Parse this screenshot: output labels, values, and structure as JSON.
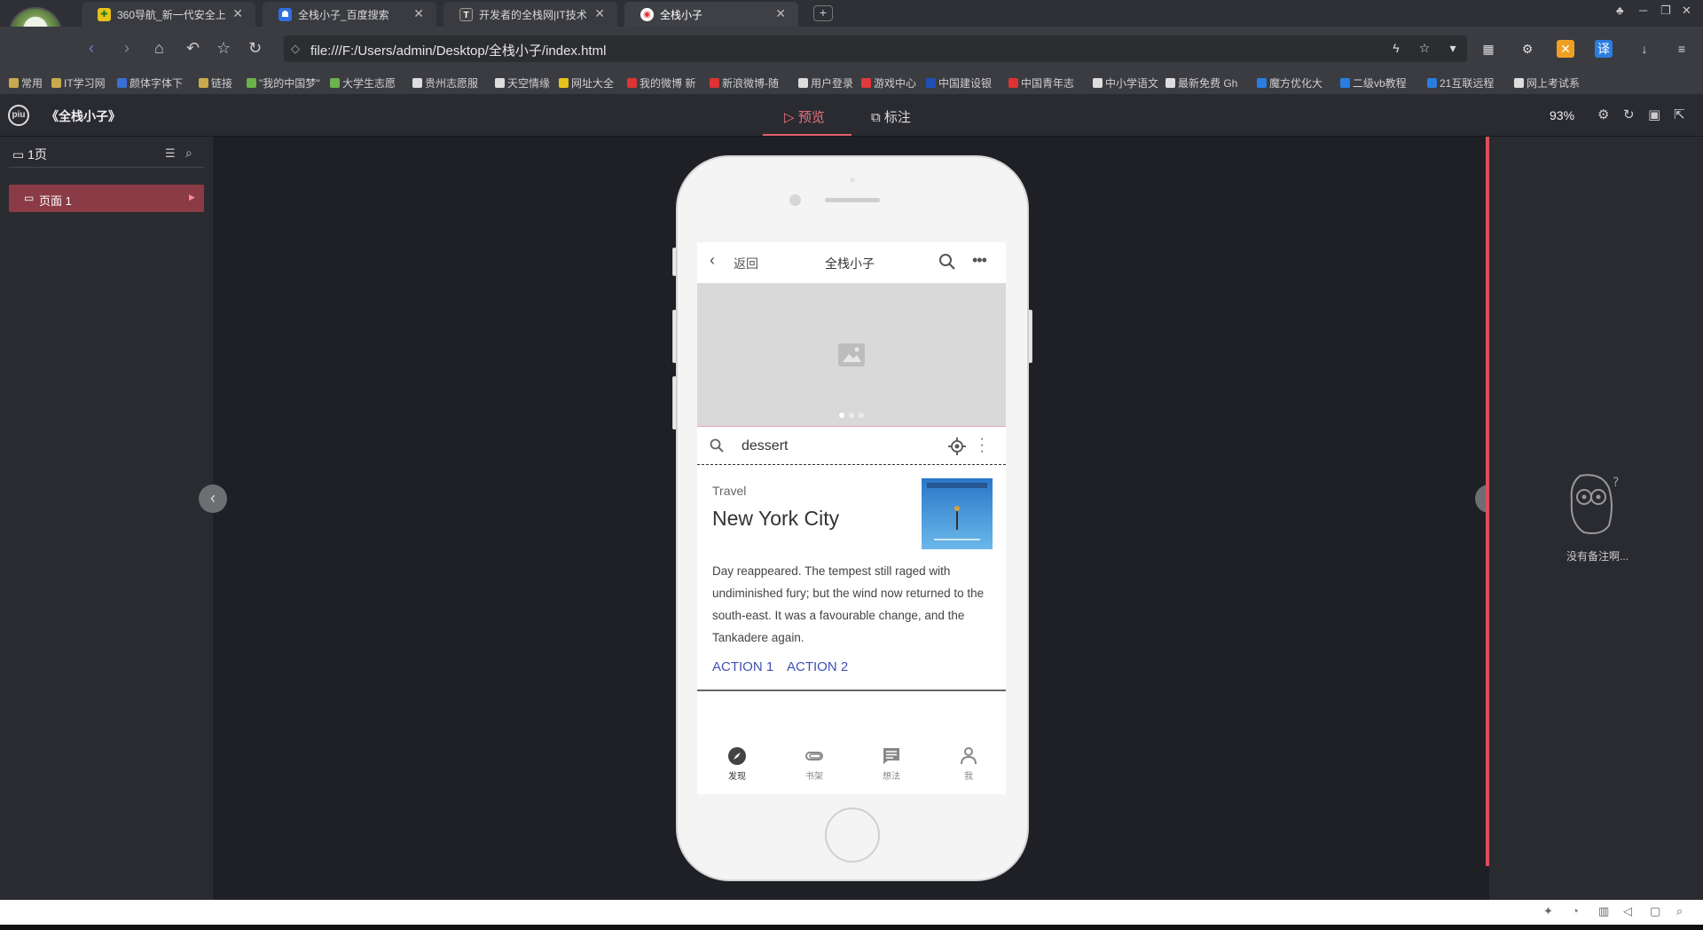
{
  "browser": {
    "tabs": [
      {
        "title": "360导航_新一代安全上",
        "icon": "shield-360-icon",
        "color": "#1a9b2f",
        "active": false
      },
      {
        "title": "全栈小子_百度搜索",
        "icon": "baidu-paw-icon",
        "color": "#2f6fe0",
        "active": false
      },
      {
        "title": "开发者的全栈网|IT技术",
        "icon": "t-logo-icon",
        "color": "#333",
        "active": false
      },
      {
        "title": "全栈小子",
        "icon": "weibo-icon",
        "color": "#d33",
        "active": true
      }
    ],
    "new_tab_symbol": "+",
    "url": "file:///F:/Users/admin/Desktop/全栈小子/index.html",
    "translate_label": "译",
    "bookmarks": [
      "常用",
      "IT学习网",
      "颜体字体下",
      "链接",
      "\"我的中国梦\"",
      "大学生志愿",
      "贵州志愿服",
      "天空情缘",
      "网址大全",
      "我的微博 新",
      "新浪微博-随",
      "用户登录",
      "游戏中心",
      "中国建设银",
      "中国青年志",
      "中小学语文",
      "最新免费 Gh",
      "魔方优化大",
      "二级vb教程",
      "21互联远程",
      "网上考试系"
    ]
  },
  "app": {
    "logo": "piu",
    "title": "《全栈小子》",
    "tab_preview": "预览",
    "tab_annotate": "标注",
    "zoom": "93%",
    "page_count": "1页",
    "page_item": "页面 1",
    "no_note": "没有备注啊..."
  },
  "phone": {
    "nav_back": "返回",
    "nav_title": "全栈小子",
    "search_value": "dessert",
    "card": {
      "overline": "Travel",
      "title": "New York City",
      "body": "Day reappeared. The tempest still raged with undiminished fury; but the wind now returned to the south-east. It was a favourable change, and the Tankadere again.",
      "action1": "ACTION 1",
      "action2": "ACTION 2"
    },
    "tabs": [
      "发现",
      "书架",
      "想法",
      "我"
    ]
  },
  "colors": {
    "accent": "#e0606c",
    "action": "#3f51b5"
  }
}
